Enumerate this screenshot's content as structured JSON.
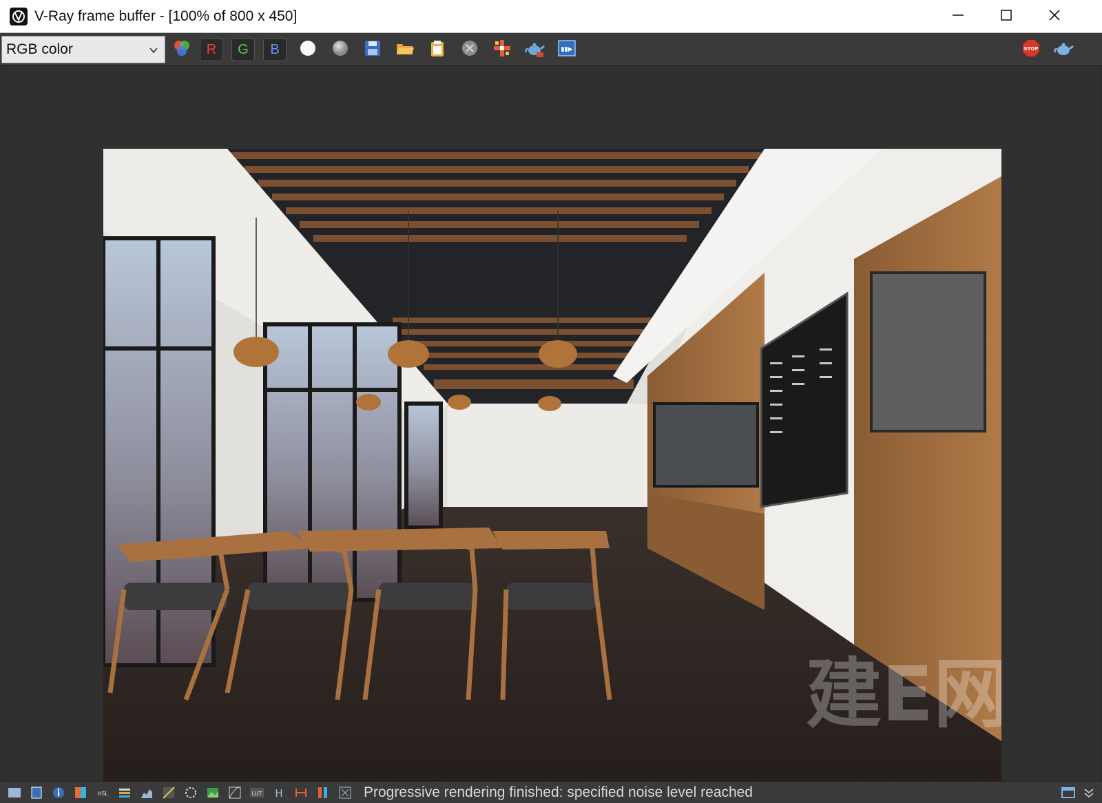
{
  "window": {
    "title": "V-Ray frame buffer - [100% of 800 x 450]",
    "controls": [
      "minimize-icon",
      "maximize-icon",
      "close-icon"
    ]
  },
  "toolbar": {
    "channel_select": {
      "selected": "RGB color"
    },
    "channel_buttons": {
      "r": "R",
      "g": "G",
      "b": "B"
    },
    "icons": [
      "color-channels-icon",
      "white-point-icon",
      "gray-point-icon",
      "save-image-icon",
      "open-image-icon",
      "clipboard-icon",
      "clear-image-icon",
      "track-mouse-icon",
      "render-teapot-icon",
      "region-render-icon",
      "stop-render-icon",
      "render-last-icon"
    ]
  },
  "render": {
    "watermark": "建E网",
    "colors": {
      "wood": "#9a6a3e",
      "ceiling_dark": "#222428",
      "floor": "#2f2825",
      "wall": "#e8e6e2"
    }
  },
  "statusbar": {
    "message": "Progressive rendering finished: specified noise level reached",
    "icons": [
      "show-history-icon",
      "frame-icon",
      "info-icon",
      "color-correction-icon",
      "hsl-icon",
      "levels-icon",
      "curve-icon",
      "exposure-icon",
      "lens-effects-icon",
      "background-icon",
      "curve-editor-icon",
      "lut-icon",
      "h-icon",
      "stereo-icon",
      "compare-icon",
      "snap-icon",
      "vfb-settings-icon",
      "expand-icon"
    ]
  }
}
